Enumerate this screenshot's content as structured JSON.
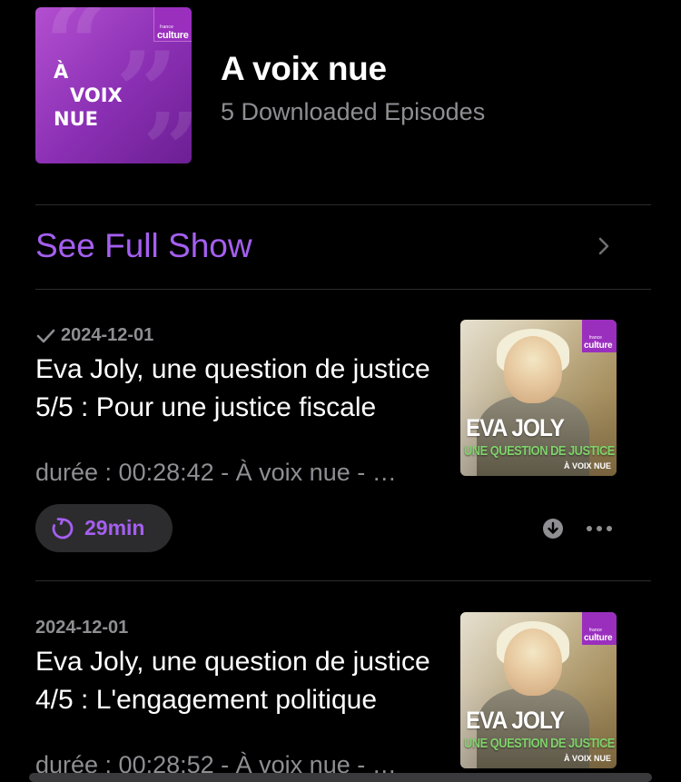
{
  "show": {
    "title": "A voix nue",
    "subtitle": "5 Downloaded Episodes",
    "art": {
      "line1": "À",
      "line2": "VOIX",
      "line3": "NUE",
      "brand_small": "france",
      "brand_big": "culture"
    }
  },
  "see_full_show": {
    "label": "See Full Show",
    "icon": "chevron-right-icon"
  },
  "episodes": [
    {
      "played": true,
      "date": "2024-12-01",
      "title": "Eva Joly, une question de justice 5/5 : Pour une justice fiscale",
      "description": "durée : 00:28:42 - À voix nue - …",
      "remaining_label": "29min",
      "art": {
        "brand_small": "france",
        "brand_big": "culture",
        "name": "EVA JOLY",
        "subtitle": "UNE QUESTION DE JUSTICE",
        "series": "À VOIX NUE"
      }
    },
    {
      "played": false,
      "date": "2024-12-01",
      "title": "Eva Joly, une question de justice 4/5 : L'engagement politique",
      "description": "durée : 00:28:52 - À voix nue - …",
      "art": {
        "brand_small": "france",
        "brand_big": "culture",
        "name": "EVA JOLY",
        "subtitle": "UNE QUESTION DE JUSTICE",
        "series": "À VOIX NUE"
      }
    }
  ],
  "colors": {
    "background": "#000000",
    "accent": "#a55ff0",
    "secondary_text": "#8e8e93",
    "divider": "#2c2c2e",
    "pill_bg": "#2c2c2e",
    "show_art": "#9a3cc4"
  }
}
